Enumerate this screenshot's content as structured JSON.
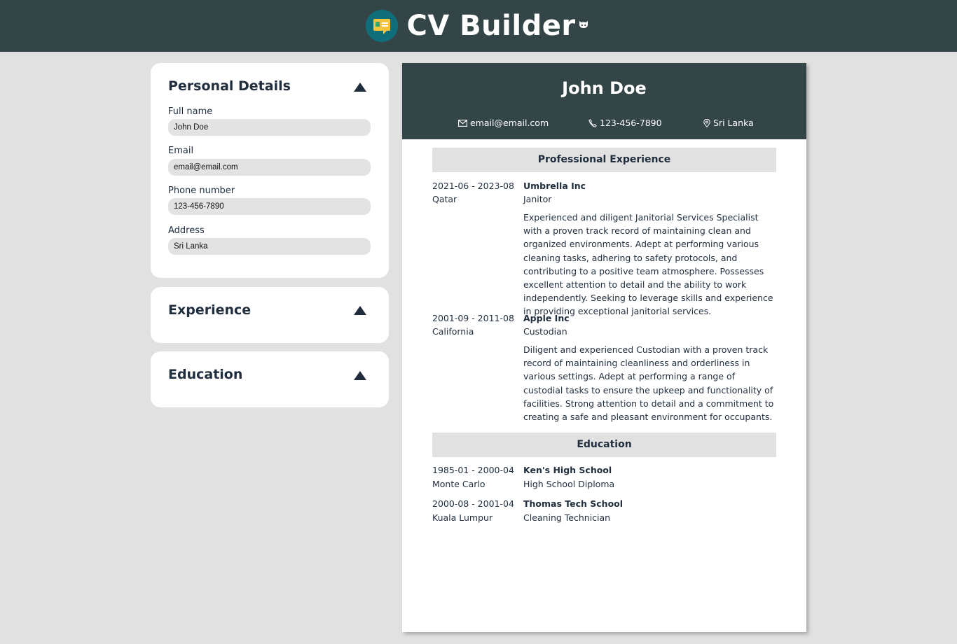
{
  "app": {
    "title": "CV Builder",
    "logo_icon": "resume-card-icon",
    "repo_icon": "github-icon",
    "header_color": "#344548"
  },
  "personal": {
    "heading": "Personal Details",
    "fields": [
      {
        "label": "Full name",
        "value": "John Doe"
      },
      {
        "label": "Email",
        "value": "email@email.com"
      },
      {
        "label": "Phone number",
        "value": "123-456-7890"
      },
      {
        "label": "Address",
        "value": "Sri Lanka"
      }
    ]
  },
  "experience_panel": {
    "heading": "Experience"
  },
  "education_panel": {
    "heading": "Education"
  },
  "resume": {
    "name": "John Doe",
    "email": "email@email.com",
    "phone": "123-456-7890",
    "location": "Sri Lanka",
    "experience_heading": "Professional Experience",
    "experience": [
      {
        "dates": "2021-06 - 2023-08",
        "location": "Qatar",
        "company": "Umbrella Inc",
        "position": "Janitor",
        "description": "Experienced and diligent Janitorial Services Specialist with a proven track record of maintaining clean and organized environments. Adept at performing various cleaning tasks, adhering to safety protocols, and contributing to a positive team atmosphere. Possesses excellent attention to detail and the ability to work independently. Seeking to leverage skills and experience in providing exceptional janitorial services."
      },
      {
        "dates": "2001-09 - 2011-08",
        "location": "California",
        "company": "Apple Inc",
        "position": "Custodian",
        "description": "Diligent and experienced Custodian with a proven track record of maintaining cleanliness and orderliness in various settings. Adept at performing a range of custodial tasks to ensure the upkeep and functionality of facilities. Strong attention to detail and a commitment to creating a safe and pleasant environment for occupants."
      }
    ],
    "education_heading": "Education",
    "education": [
      {
        "dates": "1985-01 - 2000-04",
        "location": "Monte Carlo",
        "school": "Ken's High School",
        "degree": "High School Diploma"
      },
      {
        "dates": "2000-08 - 2001-04",
        "location": "Kuala Lumpur",
        "school": "Thomas Tech School",
        "degree": "Cleaning Technician"
      }
    ]
  }
}
